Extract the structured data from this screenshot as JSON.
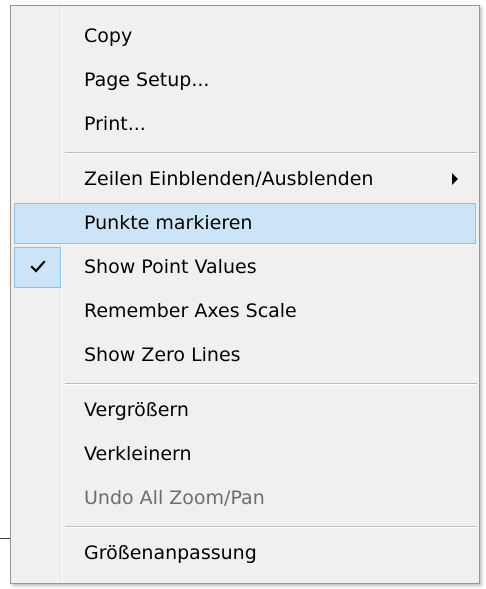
{
  "menu": {
    "items_group1": [
      {
        "label": "Copy"
      },
      {
        "label": "Page Setup..."
      },
      {
        "label": "Print..."
      }
    ],
    "items_group2": [
      {
        "label": "Zeilen Einblenden/Ausblenden",
        "submenu": true
      },
      {
        "label": "Punkte markieren",
        "highlighted": true
      },
      {
        "label": "Show Point Values",
        "checked": true
      },
      {
        "label": "Remember Axes Scale"
      },
      {
        "label": "Show Zero Lines"
      }
    ],
    "items_group3": [
      {
        "label": "Vergrößern"
      },
      {
        "label": "Verkleinern"
      },
      {
        "label": "Undo All Zoom/Pan",
        "disabled": true
      }
    ],
    "items_group4": [
      {
        "label": "Größenanpassung"
      }
    ]
  },
  "colors": {
    "menu_background": "#f0f0f0",
    "highlight_background": "#cce4f7",
    "highlight_border": "#8cc3ee",
    "disabled_text": "#6d6d6d"
  },
  "icons": {
    "check": "check-icon",
    "submenu_arrow": "submenu-arrow-icon"
  }
}
